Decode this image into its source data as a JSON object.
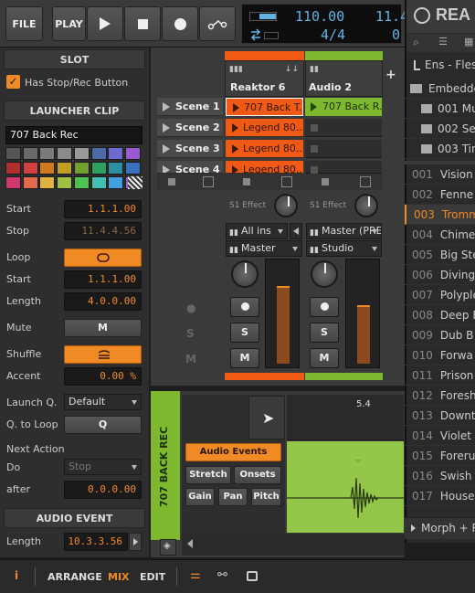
{
  "transport": {
    "file_label": "FILE",
    "play_label": "PLAY",
    "tempo": "110.00",
    "time_sig": "4/4",
    "position_partial": "11.4",
    "position_partial2": "0"
  },
  "slot": {
    "title": "SLOT",
    "has_stop_rec_label": "Has Stop/Rec Button",
    "has_stop_rec_checked": true
  },
  "launcher_clip": {
    "title": "LAUNCHER CLIP",
    "name": "707 Back Rec",
    "palette": [
      "#555555",
      "#6a6a6a",
      "#7a7a7a",
      "#8a8a8a",
      "#9a9a9a",
      "#4a6aa8",
      "#6a6ad0",
      "#9a5ad0",
      "#b03030",
      "#d04040",
      "#d07a20",
      "#c0a020",
      "#70a030",
      "#30a060",
      "#2a90a0",
      "#3a70c0",
      "#d03a70",
      "#e06a4a",
      "#e0b040",
      "#a0c040",
      "#50c050",
      "#40c0b0",
      "#40a0e0",
      "#8a6ae0"
    ],
    "start_label": "Start",
    "start": "1.1.1.00",
    "stop_label": "Stop",
    "stop": "11.4.4.56",
    "loop_label": "Loop",
    "loop_start_label": "Start",
    "loop_start": "1.1.1.00",
    "length_label": "Length",
    "length": "4.0.0.00",
    "mute_label": "Mute",
    "mute_btn": "M",
    "shuffle_label": "Shuffle",
    "accent_label": "Accent",
    "accent": "0.00 %",
    "launch_q_label": "Launch Q.",
    "launch_q": "Default",
    "q_to_loop_label": "Q. to Loop",
    "q_btn": "Q",
    "next_action_label": "Next Action",
    "do_label": "Do",
    "do_value": "Stop",
    "after_label": "after",
    "after": "0.0.0.00"
  },
  "audio_event": {
    "title": "AUDIO EVENT",
    "length_label": "Length",
    "length": "10.3.3.56"
  },
  "tracks": [
    {
      "name": "Reaktor 6",
      "color": "#f05a14",
      "effect": "S1 Effect",
      "input": "All ins",
      "output": "Master",
      "out2": "Master (PRE"
    },
    {
      "name": "Audio 2",
      "color": "#7db82e",
      "effect": "S1 Effect",
      "input": "Master (PRE",
      "output": "Studio"
    }
  ],
  "scenes": [
    "Scene 1",
    "Scene 2",
    "Scene 3",
    "Scene 4"
  ],
  "clips_track1": [
    "707 Back T...",
    "Legend 80...",
    "Legend 80...",
    "Legend 80..."
  ],
  "clips_track2": [
    "707 Back R..."
  ],
  "mixer_buttons": {
    "solo": "S",
    "mute": "M"
  },
  "browser": {
    "title": "REA",
    "path": "Ens - Flesh",
    "embedded": "Embedde",
    "folders": [
      "001 Mu",
      "002 Sec",
      "003 Tim"
    ],
    "items": [
      {
        "num": "001",
        "name": "Vision"
      },
      {
        "num": "002",
        "name": "Fenne"
      },
      {
        "num": "003",
        "name": "Tromm"
      },
      {
        "num": "004",
        "name": "Chime"
      },
      {
        "num": "005",
        "name": "Big Ste"
      },
      {
        "num": "006",
        "name": "Diving"
      },
      {
        "num": "007",
        "name": "Polyple"
      },
      {
        "num": "008",
        "name": "Deep B"
      },
      {
        "num": "009",
        "name": "Dub B"
      },
      {
        "num": "010",
        "name": "Forwa"
      },
      {
        "num": "011",
        "name": "Prison"
      },
      {
        "num": "012",
        "name": "Foresh"
      },
      {
        "num": "013",
        "name": "Downt"
      },
      {
        "num": "014",
        "name": "Violet"
      },
      {
        "num": "015",
        "name": "Forerui"
      },
      {
        "num": "016",
        "name": "Swish"
      },
      {
        "num": "017",
        "name": "House"
      }
    ],
    "footer": "Morph + Ra"
  },
  "editor": {
    "track_label": "707 BACK REC",
    "position": "5.4",
    "audio_events_btn": "Audio Events",
    "stretch_btn": "Stretch",
    "onsets_btn": "Onsets",
    "gain_btn": "Gain",
    "pan_btn": "Pan",
    "pitch_btn": "Pitch"
  },
  "footer": {
    "arrange": "ARRANGE",
    "mix": "MIX",
    "edit": "EDIT",
    "info_icon": "i"
  }
}
